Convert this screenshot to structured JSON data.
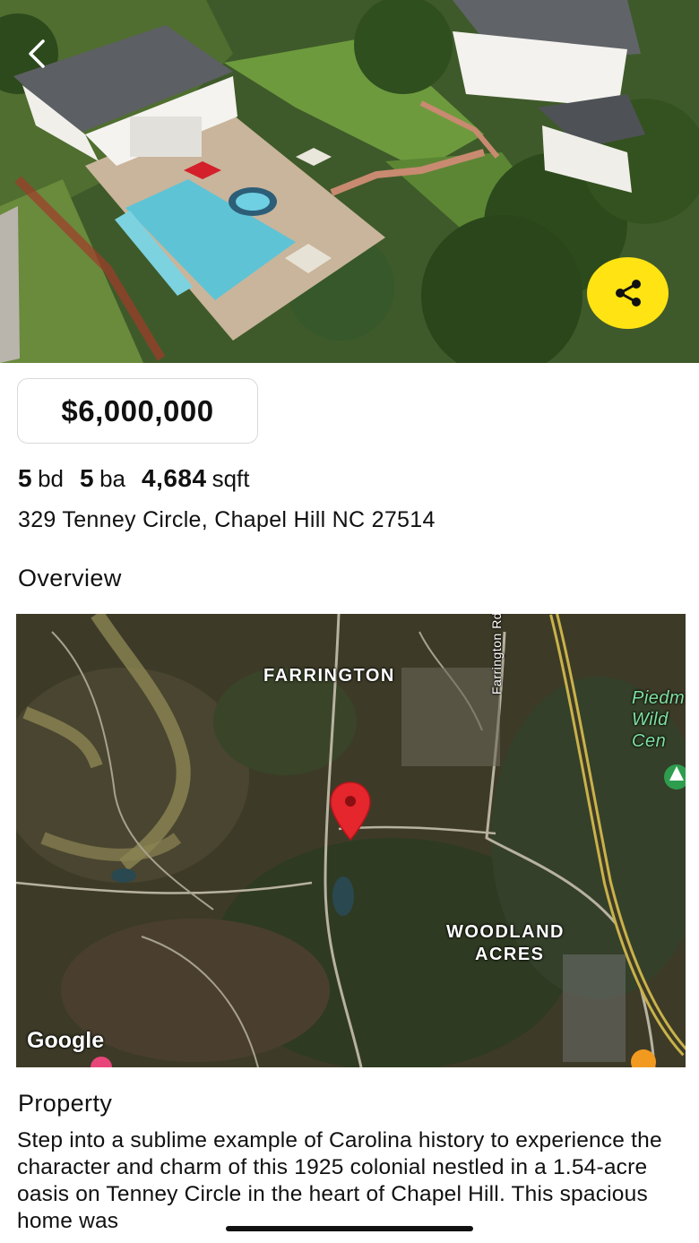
{
  "listing": {
    "price": "$6,000,000",
    "beds_num": "5",
    "beds_unit": "bd",
    "baths_num": "5",
    "baths_unit": "ba",
    "sqft_num": "4,684",
    "sqft_unit": "sqft",
    "address": "329 Tenney Circle, Chapel Hill NC 27514"
  },
  "sections": {
    "overview": "Overview",
    "property": "Property"
  },
  "map": {
    "label_farrington": "FARRINGTON",
    "label_woodland_1": "WOODLAND",
    "label_woodland_2": "ACRES",
    "road_label": "Farrington Rd",
    "poi_label": "Piedm\nWild\nCen",
    "provider": "Google",
    "pin_color": "#e5262c"
  },
  "description": "Step into a sublime example of Carolina history to experience the character and charm of this 1925 colonial nestled in a 1.54-acre oasis on Tenney Circle in the heart of Chapel Hill. This spacious home was",
  "icons": {
    "back": "chevron-left-icon",
    "share": "share-icon",
    "pin": "map-pin-icon"
  },
  "colors": {
    "share_button": "#ffe313"
  }
}
